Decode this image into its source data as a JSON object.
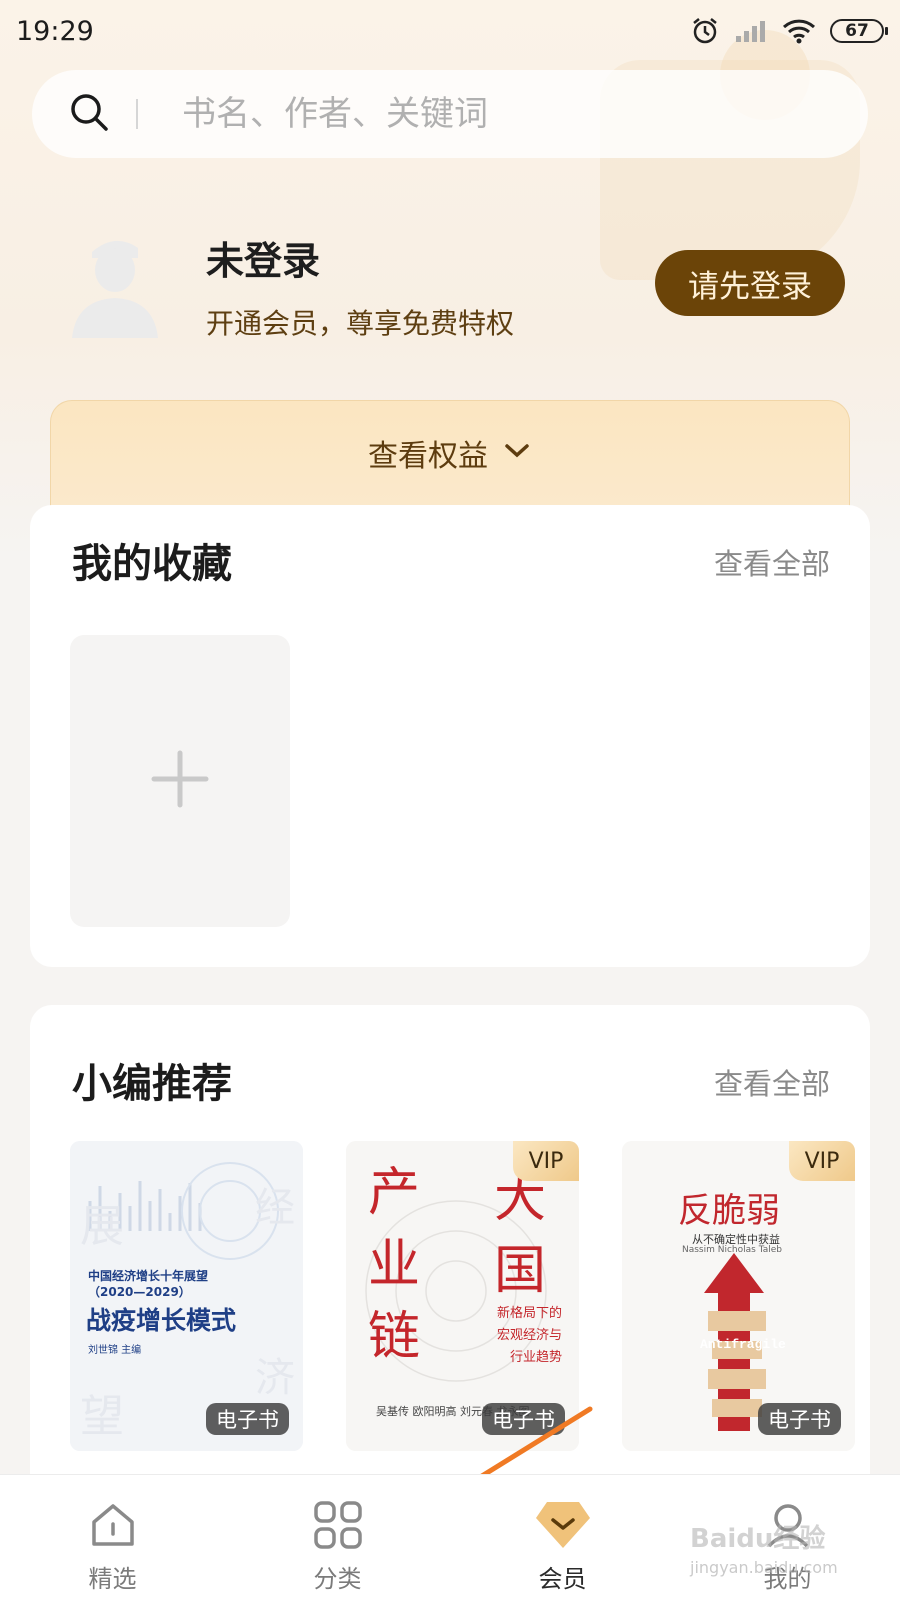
{
  "status_bar": {
    "time": "19:29",
    "battery": "67"
  },
  "search": {
    "placeholder": "书名、作者、关键词"
  },
  "profile": {
    "name": "未登录",
    "subtitle": "开通会员，尊享免费特权",
    "login_button": "请先登录"
  },
  "benefits": {
    "label": "查看权益"
  },
  "favorites": {
    "title": "我的收藏",
    "view_all": "查看全部"
  },
  "recommend": {
    "title": "小编推荐",
    "view_all": "查看全部",
    "books": [
      {
        "cover_line1": "中国经济增长十年展望",
        "cover_line2": "（2020—2029）",
        "cover_title": "战疫增长模式",
        "cover_author": "刘世锦 主编",
        "vip": "",
        "tag": "电子书"
      },
      {
        "cover_title_left": "产业链",
        "cover_title_right": "大国",
        "cover_sub": "新格局下的宏观经济与行业趋势",
        "cover_author": "吴基传 欧阳明高 刘元春 龙永图",
        "vip": "VIP",
        "tag": "电子书"
      },
      {
        "cover_title": "反脆弱",
        "cover_sub": "从不确定性中获益",
        "cover_en": "Antifragile",
        "cover_author": "Nassim Nicholas Taleb",
        "vip": "VIP",
        "tag": "电子书"
      }
    ]
  },
  "bottom_nav": {
    "items": [
      {
        "label": "精选",
        "icon": "home-icon"
      },
      {
        "label": "分类",
        "icon": "grid-icon"
      },
      {
        "label": "会员",
        "icon": "vip-diamond-icon",
        "active": true
      },
      {
        "label": "我的",
        "icon": "profile-icon"
      }
    ]
  },
  "watermark": {
    "text": "Baidu经验",
    "sub": "jingyan.baidu.com"
  },
  "colors": {
    "accent_brown": "#6b4408",
    "gold": "#f0c27a",
    "benefit_bg": "#fbe6c1"
  }
}
